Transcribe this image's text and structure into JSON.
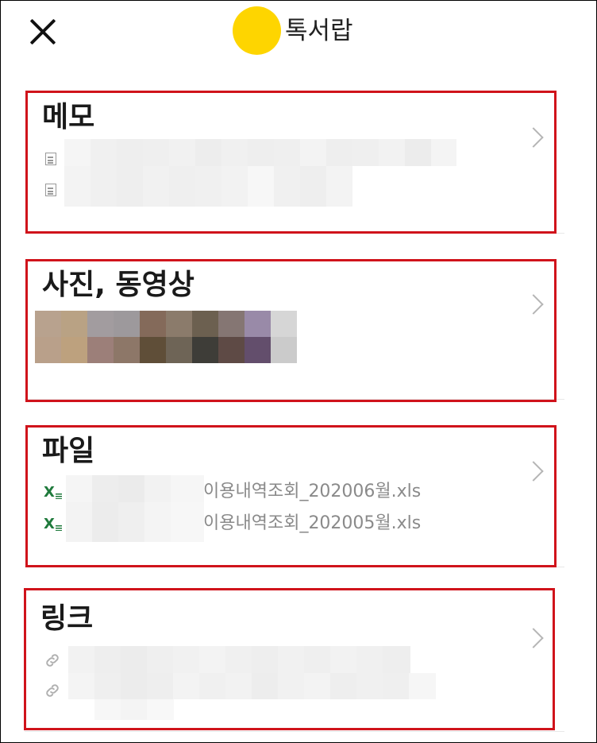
{
  "header": {
    "title": "톡서랍",
    "close_icon": "close-icon",
    "avatar_color": "#fed500"
  },
  "sections": {
    "memo": {
      "title": "메모",
      "item_icon": "memo-icon"
    },
    "media": {
      "title": "사진, 동영상"
    },
    "files": {
      "title": "파일",
      "items": [
        {
          "name": "이용내역조회_202006월.xls",
          "icon": "excel-icon"
        },
        {
          "name": "이용내역조회_202005월.xls",
          "icon": "excel-icon"
        }
      ]
    },
    "links": {
      "title": "링크",
      "item_icon": "link-icon"
    }
  },
  "colors": {
    "highlight_border": "#d0131b",
    "chevron": "#b5b5b5",
    "excel_green": "#1f7a3c"
  }
}
